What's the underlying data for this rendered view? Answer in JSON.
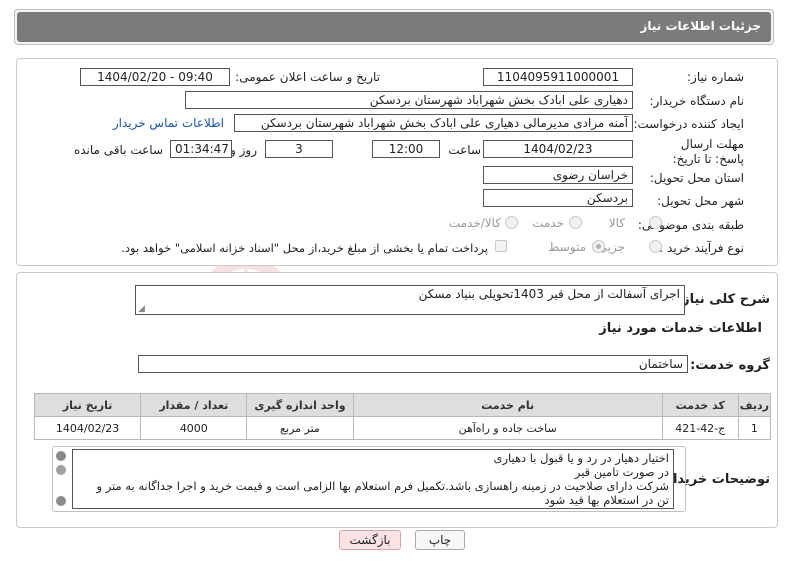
{
  "header": {
    "title": "جزئیات اطلاعات نیاز"
  },
  "form": {
    "need_number": {
      "label": "شماره نیاز:",
      "value": "1104095911000001"
    },
    "announce_datetime": {
      "label": "تاریخ و ساعت اعلان عمومی:",
      "value": "1404/02/20 - 09:40"
    },
    "buyer_org": {
      "label": "نام دستگاه خریدار:",
      "value": "دهیاری علی ابادک بخش شهراباد شهرستان بردسکن"
    },
    "requester": {
      "label": "ایجاد کننده درخواست:",
      "value": "آمنه مرادی مدیرمالی دهیاری علی ابادک بخش شهراباد شهرستان بردسکن",
      "contact_link": "اطلاعات تماس خریدار"
    },
    "deadline": {
      "label": "مهلت ارسال پاسخ: تا تاریخ:",
      "date": "1404/02/23",
      "time_label": "ساعت",
      "time": "12:00",
      "days": "3",
      "days_label": "روز و",
      "remaining": "01:34:47",
      "remaining_label": "ساعت باقی مانده"
    },
    "province": {
      "label": "استان محل تحویل:",
      "value": "خراسان رضوی"
    },
    "city": {
      "label": "شهر محل تحویل:",
      "value": "بردسکن"
    },
    "category": {
      "label": "طبقه بندی موضوعی:",
      "options": [
        "کالا",
        "خدمت",
        "کالا/خدمت"
      ]
    },
    "purchase_type": {
      "label": "نوع فرآیند خرید :",
      "options": [
        "جزیی",
        "متوسط"
      ],
      "selected": "متوسط",
      "payment_note": "پرداخت تمام یا بخشی از مبلغ خرید،از محل \"اسناد خزانه اسلامی\" خواهد بود."
    }
  },
  "summary": {
    "label": "شرح کلی نیاز:",
    "value": "اجرای آسفالت از محل قیر 1403تحویلی بنیاد مسکن",
    "services_title": "اطلاعات خدمات مورد نیاز",
    "service_group_label": "گروه خدمت:",
    "service_group_value": "ساختمان"
  },
  "table": {
    "headers": [
      "ردیف",
      "کد خدمت",
      "نام خدمت",
      "واحد اندازه گیری",
      "تعداد / مقدار",
      "تاریخ نیاز"
    ],
    "rows": [
      [
        "1",
        "ج-42-421",
        "ساخت جاده و راه‌آهن",
        "متر مربع",
        "4000",
        "1404/02/23"
      ]
    ]
  },
  "buyer_notes": {
    "label": "توضیحات خریدار:",
    "lines": [
      "اختیار دهیار در رد و یا قبول با دهیاری",
      "در صورت تامین قیر",
      "شرکت  دارای صلاحیت در زمینه راهسازی باشد.تکمیل فرم استعلام بها الزامی است و قیمت خرید و اجرا جداگانه به متر و",
      "تن در استعلام بها قید شود"
    ]
  },
  "buttons": {
    "print": "چاپ",
    "back": "بازگشت"
  },
  "watermark": "AriaTender.neT",
  "colors": {
    "header_bg": "#7b7b7b",
    "link": "#1a55b0",
    "back_button": "#fbe3e3",
    "watermark": "#c0262d"
  }
}
